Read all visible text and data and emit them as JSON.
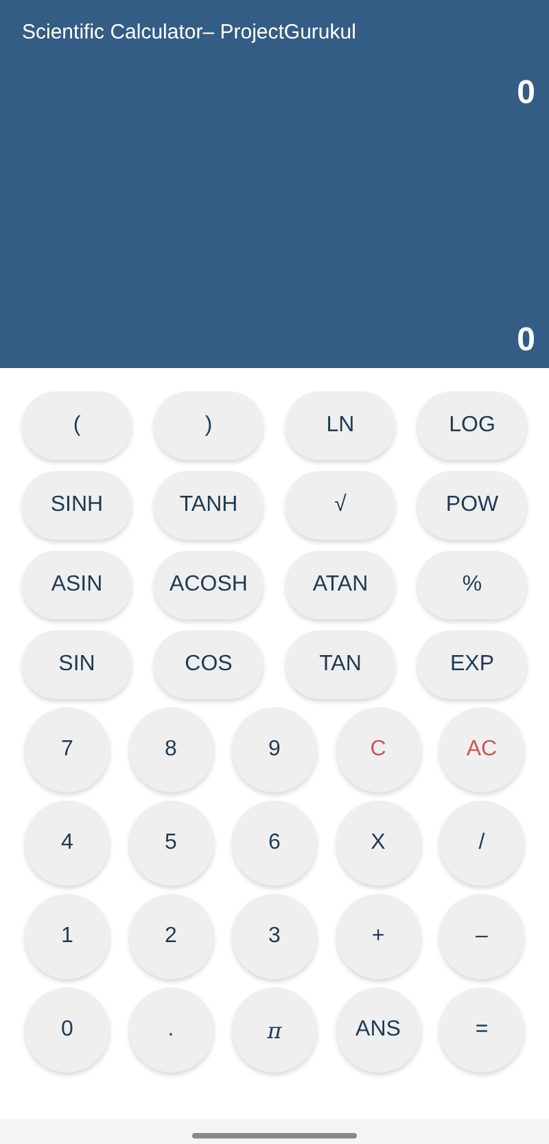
{
  "title": "Scientific Calculator– ProjectGurukul",
  "display": {
    "expression": "0",
    "result": "0"
  },
  "function_keys": [
    {
      "label": "("
    },
    {
      "label": ")"
    },
    {
      "label": "LN"
    },
    {
      "label": "LOG"
    },
    {
      "label": "SINH"
    },
    {
      "label": "TANH"
    },
    {
      "label": "√"
    },
    {
      "label": "POW"
    },
    {
      "label": "ASIN"
    },
    {
      "label": "ACOSH"
    },
    {
      "label": "ATAN"
    },
    {
      "label": "%"
    },
    {
      "label": "SIN"
    },
    {
      "label": "COS"
    },
    {
      "label": "TAN"
    },
    {
      "label": "EXP"
    }
  ],
  "number_keys": [
    {
      "label": "7",
      "kind": "plain"
    },
    {
      "label": "8",
      "kind": "plain"
    },
    {
      "label": "9",
      "kind": "plain"
    },
    {
      "label": "C",
      "kind": "clear"
    },
    {
      "label": "AC",
      "kind": "clear"
    },
    {
      "label": "4",
      "kind": "plain"
    },
    {
      "label": "5",
      "kind": "plain"
    },
    {
      "label": "6",
      "kind": "plain"
    },
    {
      "label": "X",
      "kind": "plain"
    },
    {
      "label": "/",
      "kind": "plain"
    },
    {
      "label": "1",
      "kind": "plain"
    },
    {
      "label": "2",
      "kind": "plain"
    },
    {
      "label": "3",
      "kind": "plain"
    },
    {
      "label": "+",
      "kind": "plain"
    },
    {
      "label": "–",
      "kind": "plain"
    },
    {
      "label": "0",
      "kind": "plain"
    },
    {
      "label": ".",
      "kind": "plain"
    },
    {
      "label": "π",
      "kind": "symbol"
    },
    {
      "label": "ANS",
      "kind": "plain"
    },
    {
      "label": "=",
      "kind": "plain"
    }
  ]
}
